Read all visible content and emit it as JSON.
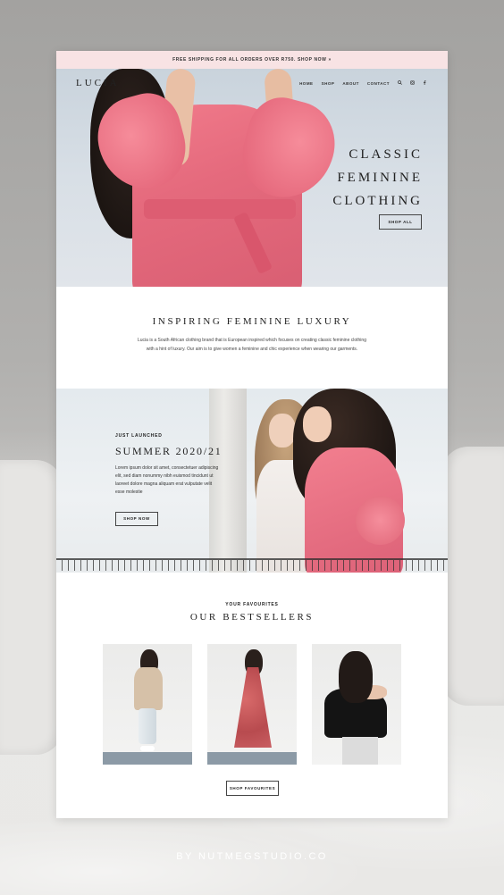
{
  "announcement": "FREE SHIPPING FOR ALL ORDERS OVER R750. SHOP NOW »",
  "header": {
    "logo": "LUCIA",
    "nav": [
      "HOME",
      "SHOP",
      "ABOUT",
      "CONTACT"
    ],
    "icons": [
      "search-icon",
      "instagram-icon",
      "facebook-icon"
    ]
  },
  "hero": {
    "title_lines": [
      "CLASSIC",
      "FEMININE",
      "CLOTHING"
    ],
    "button": "SHOP ALL"
  },
  "intro": {
    "heading": "INSPIRING FEMININE LUXURY",
    "body": "Lucia is a South African clothing brand that is European inspired which focuses on creating classic feminine clothing with a hint of luxury. Our aim is to give women a feminine and chic experience when wearing our garments."
  },
  "launch": {
    "kicker": "JUST LAUNCHED",
    "heading": "SUMMER 2020/21",
    "body": "Lorem ipsum dolor sit amet, consectetuer adipiscing elit, sed diam nonummy nibh euismod tincidunt ut laoreet dolore magna aliquam erat vulputate velit esse molestie",
    "button": "SHOP NOW"
  },
  "bestsellers": {
    "kicker": "YOUR FAVOURITES",
    "heading": "OUR BESTSELLERS",
    "button": "SHOP FAVOURITES"
  },
  "credit": "BY NUTMEGSTUDIO.CO",
  "colors": {
    "announcement_bg": "#f8e3e4",
    "accent_pink": "#e56a7d",
    "text": "#222222"
  }
}
